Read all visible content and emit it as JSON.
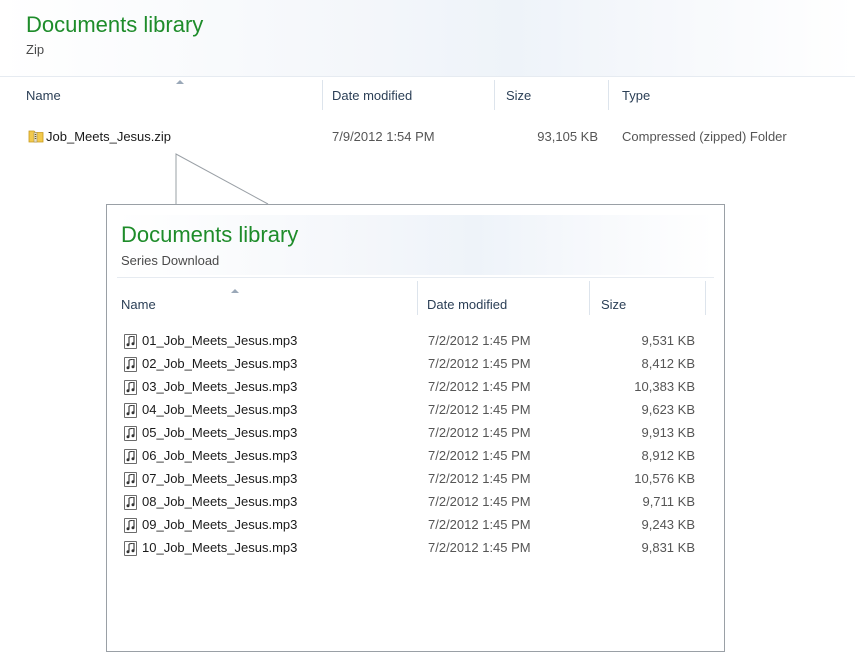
{
  "outer": {
    "title": "Documents library",
    "subtitle": "Zip",
    "columns": {
      "name": "Name",
      "date": "Date modified",
      "size": "Size",
      "type": "Type"
    },
    "file": {
      "name": "Job_Meets_Jesus.zip",
      "date": "7/9/2012 1:54 PM",
      "size": "93,105 KB",
      "type": "Compressed (zipped) Folder",
      "icon": "zip-folder-icon"
    }
  },
  "inner": {
    "title": "Documents library",
    "subtitle": "Series Download",
    "columns": {
      "name": "Name",
      "date": "Date modified",
      "size": "Size"
    },
    "files": [
      {
        "name": "01_Job_Meets_Jesus.mp3",
        "date": "7/2/2012 1:45 PM",
        "size": "9,531 KB"
      },
      {
        "name": "02_Job_Meets_Jesus.mp3",
        "date": "7/2/2012 1:45 PM",
        "size": "8,412 KB"
      },
      {
        "name": "03_Job_Meets_Jesus.mp3",
        "date": "7/2/2012 1:45 PM",
        "size": "10,383 KB"
      },
      {
        "name": "04_Job_Meets_Jesus.mp3",
        "date": "7/2/2012 1:45 PM",
        "size": "9,623 KB"
      },
      {
        "name": "05_Job_Meets_Jesus.mp3",
        "date": "7/2/2012 1:45 PM",
        "size": "9,913 KB"
      },
      {
        "name": "06_Job_Meets_Jesus.mp3",
        "date": "7/2/2012 1:45 PM",
        "size": "8,912 KB"
      },
      {
        "name": "07_Job_Meets_Jesus.mp3",
        "date": "7/2/2012 1:45 PM",
        "size": "10,576 KB"
      },
      {
        "name": "08_Job_Meets_Jesus.mp3",
        "date": "7/2/2012 1:45 PM",
        "size": "9,711 KB"
      },
      {
        "name": "09_Job_Meets_Jesus.mp3",
        "date": "7/2/2012 1:45 PM",
        "size": "9,243 KB"
      },
      {
        "name": "10_Job_Meets_Jesus.mp3",
        "date": "7/2/2012 1:45 PM",
        "size": "9,831 KB"
      }
    ],
    "file_icon": "audio-file-icon"
  },
  "colors": {
    "title_green": "#1e8c2a",
    "header_text": "#2b3f56"
  }
}
